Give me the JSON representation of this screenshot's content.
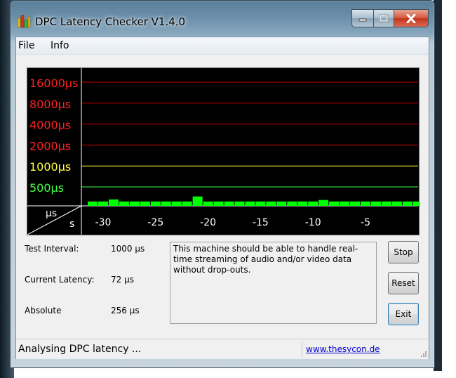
{
  "window": {
    "title": "DPC Latency Checker V1.4.0",
    "icon": "app-bars-icon",
    "controls": [
      "minimize-icon",
      "maximize-icon",
      "close-icon"
    ]
  },
  "menu": {
    "file": "File",
    "info": "Info"
  },
  "chart_data": {
    "type": "bar",
    "title": "",
    "xlabel": "s",
    "ylabel": "µs",
    "x_ticks": [
      "-30",
      "-25",
      "-20",
      "-15",
      "-10",
      "-5"
    ],
    "y_ticks": [
      {
        "label": "16000µs",
        "value": 16000,
        "color": "#ff2020"
      },
      {
        "label": "8000µs",
        "value": 8000,
        "color": "#ff2020"
      },
      {
        "label": "4000µs",
        "value": 4000,
        "color": "#ff2020"
      },
      {
        "label": "2000µs",
        "value": 2000,
        "color": "#ff2020"
      },
      {
        "label": "1000µs",
        "value": 1000,
        "color": "#ffff40"
      },
      {
        "label": "500µs",
        "value": 500,
        "color": "#40ff40"
      }
    ],
    "x": [
      -34,
      -33,
      -32,
      -31,
      -30,
      -29,
      -28,
      -27,
      -26,
      -25,
      -24,
      -23,
      -22,
      -21,
      -20,
      -19,
      -18,
      -17,
      -16,
      -15,
      -14,
      -13,
      -12,
      -11,
      -10,
      -9,
      -8,
      -7,
      -6,
      -5,
      -4,
      -3,
      -2,
      -1,
      0
    ],
    "values": [
      75,
      75,
      75,
      75,
      75,
      110,
      75,
      75,
      75,
      75,
      75,
      75,
      75,
      160,
      75,
      75,
      75,
      75,
      75,
      75,
      75,
      75,
      75,
      75,
      75,
      100,
      75,
      75,
      75,
      75,
      75,
      75,
      75,
      75,
      75
    ],
    "bar_color": "#00ff00",
    "grid": true
  },
  "stats": {
    "interval_label": "Test Interval:",
    "interval_value": "1000 µs",
    "current_label": "Current Latency:",
    "current_value": "72 µs",
    "absolute_label": "Absolute",
    "absolute_value": "256 µs"
  },
  "message": "This machine should be able to handle real-time streaming of audio and/or video data without drop-outs.",
  "buttons": {
    "stop": "Stop",
    "reset": "Reset",
    "exit": "Exit"
  },
  "status": {
    "text": "Analysing DPC latency ...",
    "link": "www.thesycon.de"
  }
}
